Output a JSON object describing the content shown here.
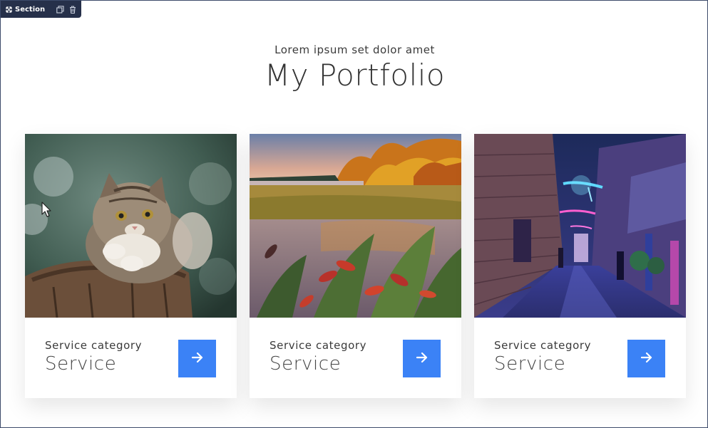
{
  "editor": {
    "section_label": "Section",
    "icons": [
      "expand-icon",
      "duplicate-icon",
      "trash-icon"
    ]
  },
  "header": {
    "subtitle": "Lorem ipsum set dolor amet",
    "title": "My Portfolio"
  },
  "cards": [
    {
      "image": "kitten-photo",
      "category": "Service category",
      "name": "Service",
      "button_icon": "arrow-right-icon"
    },
    {
      "image": "autumn-lake-photo",
      "category": "Service category",
      "name": "Service",
      "button_icon": "arrow-right-icon"
    },
    {
      "image": "neon-alley-photo",
      "category": "Service category",
      "name": "Service",
      "button_icon": "arrow-right-icon"
    }
  ],
  "colors": {
    "accent": "#3b82f6",
    "editor_bar": "#26304a",
    "text": "#333333"
  }
}
